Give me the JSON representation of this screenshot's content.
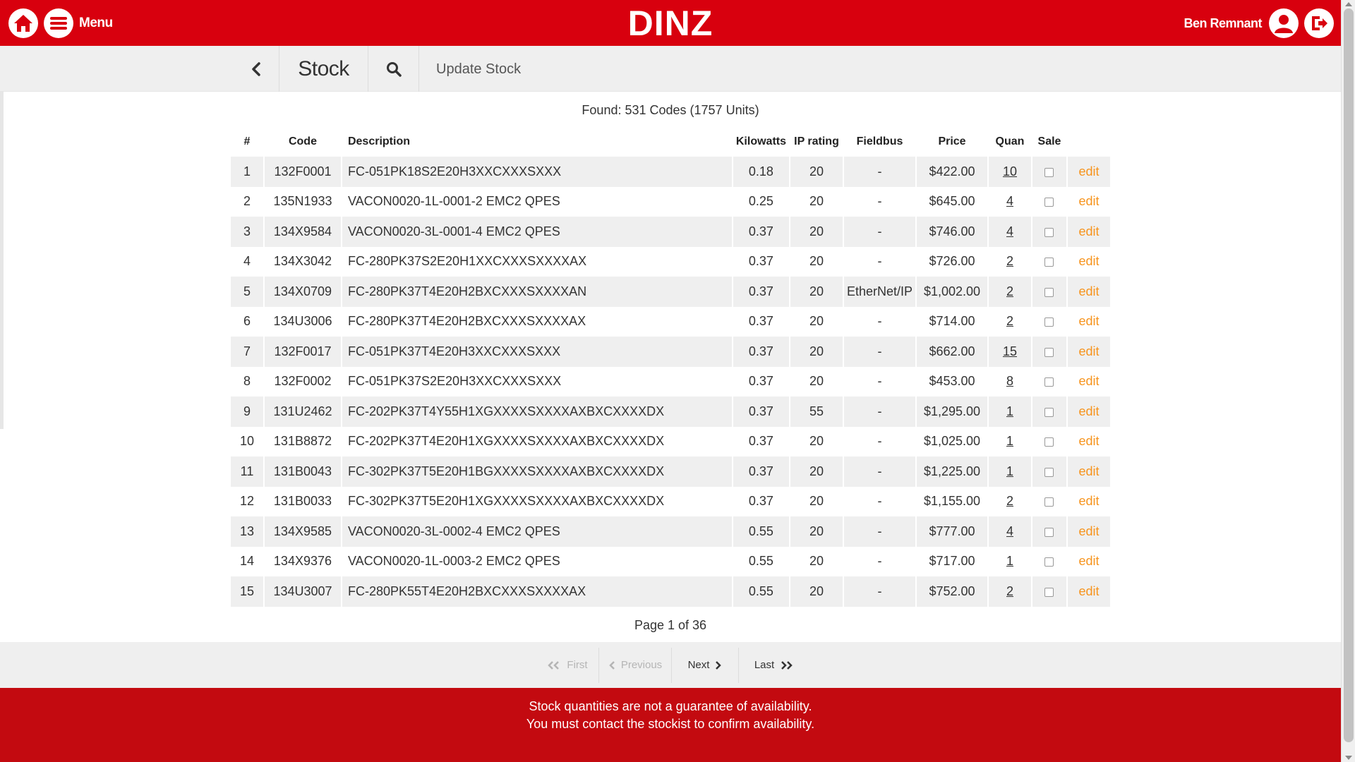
{
  "header": {
    "brand": "DINZ",
    "menu_label": "Menu",
    "user_name": "Ben Remnant",
    "icons": [
      "home-icon",
      "menu-icon",
      "user-icon",
      "logout-icon"
    ],
    "brand_color": "#d8000e"
  },
  "subnav": {
    "title": "Stock",
    "update_label": "Update Stock"
  },
  "results": {
    "found_text": "Found: 531 Codes (1757 Units)",
    "page_text": "Page 1 of 36"
  },
  "table": {
    "headers": [
      "#",
      "Code",
      "Description",
      "Kilowatts",
      "IP rating",
      "Fieldbus",
      "Price",
      "Quan",
      "Sale",
      ""
    ],
    "edit_label": "edit",
    "rows": [
      {
        "num": "1",
        "code": "132F0001",
        "desc": "FC-051PK18S2E20H3XXCXXXSXXX",
        "kw": "0.18",
        "ip": "20",
        "fieldbus": "-",
        "price": "$422.00",
        "quan": "10"
      },
      {
        "num": "2",
        "code": "135N1933",
        "desc": "VACON0020-1L-0001-2 EMC2 QPES",
        "kw": "0.25",
        "ip": "20",
        "fieldbus": "-",
        "price": "$645.00",
        "quan": "4"
      },
      {
        "num": "3",
        "code": "134X9584",
        "desc": "VACON0020-3L-0001-4 EMC2 QPES",
        "kw": "0.37",
        "ip": "20",
        "fieldbus": "-",
        "price": "$746.00",
        "quan": "4"
      },
      {
        "num": "4",
        "code": "134X3042",
        "desc": "FC-280PK37S2E20H1XXCXXXSXXXXAX",
        "kw": "0.37",
        "ip": "20",
        "fieldbus": "-",
        "price": "$726.00",
        "quan": "2"
      },
      {
        "num": "5",
        "code": "134X0709",
        "desc": "FC-280PK37T4E20H2BXCXXXSXXXXAN",
        "kw": "0.37",
        "ip": "20",
        "fieldbus": "EtherNet/IP",
        "price": "$1,002.00",
        "quan": "2"
      },
      {
        "num": "6",
        "code": "134U3006",
        "desc": "FC-280PK37T4E20H2BXCXXXSXXXXAX",
        "kw": "0.37",
        "ip": "20",
        "fieldbus": "-",
        "price": "$714.00",
        "quan": "2"
      },
      {
        "num": "7",
        "code": "132F0017",
        "desc": "FC-051PK37T4E20H3XXCXXXSXXX",
        "kw": "0.37",
        "ip": "20",
        "fieldbus": "-",
        "price": "$662.00",
        "quan": "15"
      },
      {
        "num": "8",
        "code": "132F0002",
        "desc": "FC-051PK37S2E20H3XXCXXXSXXX",
        "kw": "0.37",
        "ip": "20",
        "fieldbus": "-",
        "price": "$453.00",
        "quan": "8"
      },
      {
        "num": "9",
        "code": "131U2462",
        "desc": "FC-202PK37T4Y55H1XGXXXXSXXXXAXBXCXXXXDX",
        "kw": "0.37",
        "ip": "55",
        "fieldbus": "-",
        "price": "$1,295.00",
        "quan": "1"
      },
      {
        "num": "10",
        "code": "131B8872",
        "desc": "FC-202PK37T4E20H1XGXXXXSXXXXAXBXCXXXXDX",
        "kw": "0.37",
        "ip": "20",
        "fieldbus": "-",
        "price": "$1,025.00",
        "quan": "1"
      },
      {
        "num": "11",
        "code": "131B0043",
        "desc": "FC-302PK37T5E20H1BGXXXXSXXXXAXBXCXXXXDX",
        "kw": "0.37",
        "ip": "20",
        "fieldbus": "-",
        "price": "$1,225.00",
        "quan": "1"
      },
      {
        "num": "12",
        "code": "131B0033",
        "desc": "FC-302PK37T5E20H1XGXXXXSXXXXAXBXCXXXXDX",
        "kw": "0.37",
        "ip": "20",
        "fieldbus": "-",
        "price": "$1,155.00",
        "quan": "2"
      },
      {
        "num": "13",
        "code": "134X9585",
        "desc": "VACON0020-3L-0002-4 EMC2 QPES",
        "kw": "0.55",
        "ip": "20",
        "fieldbus": "-",
        "price": "$777.00",
        "quan": "4"
      },
      {
        "num": "14",
        "code": "134X9376",
        "desc": "VACON0020-1L-0003-2 EMC2 QPES",
        "kw": "0.55",
        "ip": "20",
        "fieldbus": "-",
        "price": "$717.00",
        "quan": "1"
      },
      {
        "num": "15",
        "code": "134U3007",
        "desc": "FC-280PK55T4E20H2BXCXXXSXXXXAX",
        "kw": "0.55",
        "ip": "20",
        "fieldbus": "-",
        "price": "$752.00",
        "quan": "2"
      }
    ]
  },
  "pager": {
    "first": "First",
    "previous": "Previous",
    "next": "Next",
    "last": "Last"
  },
  "footer": {
    "line1": "Stock quantities are not a guarantee of availability.",
    "line2": "You must contact the stockist to confirm availability."
  }
}
